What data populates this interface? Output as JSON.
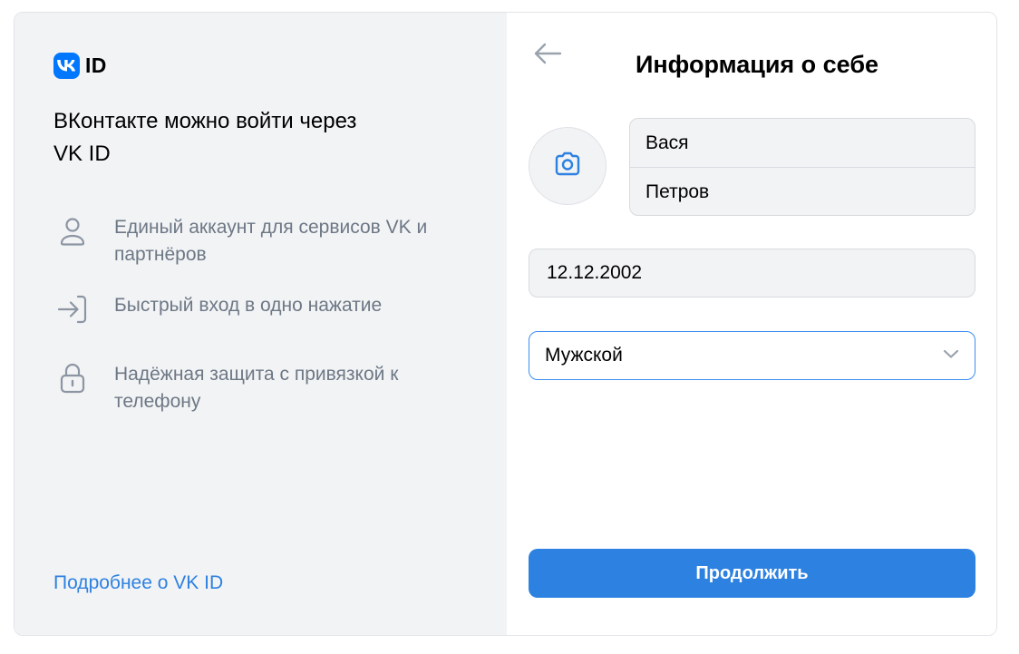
{
  "brand": {
    "logo_text": "ID",
    "logo_badge_letters": "VK",
    "accent_color": "#0077ff"
  },
  "left": {
    "tagline": "ВКонтакте можно войти через VK ID",
    "features": [
      {
        "icon": "user-icon",
        "text": "Единый аккаунт для сервисов VK и партнёров"
      },
      {
        "icon": "login-arrow-icon",
        "text": "Быстрый вход в одно нажатие"
      },
      {
        "icon": "lock-icon",
        "text": "Надёжная защита с привязкой к телефону"
      }
    ],
    "more_link": "Подробнее о VK ID"
  },
  "right": {
    "back_icon": "arrow-left-icon",
    "title": "Информация о себе",
    "avatar_icon": "camera-icon",
    "first_name": "Вася",
    "last_name": "Петров",
    "birth_date": "12.12.2002",
    "gender": {
      "selected": "Мужской",
      "icon": "chevron-down-icon"
    },
    "continue_label": "Продолжить",
    "button_color": "#2d81e0",
    "focus_border_color": "#3b8ef0"
  }
}
